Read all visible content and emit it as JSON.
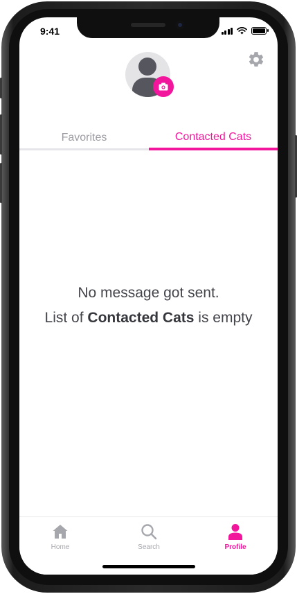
{
  "status_bar": {
    "time": "9:41"
  },
  "profile": {
    "avatar_icon": "user-silhouette-icon",
    "camera_icon": "camera-icon",
    "settings_icon": "gear-icon"
  },
  "tabs": [
    {
      "label": "Favorites",
      "active": false
    },
    {
      "label": "Contacted Cats",
      "active": true
    }
  ],
  "empty_state": {
    "line1": "No message got sent.",
    "line2_prefix": "List of ",
    "line2_bold": "Contacted Cats",
    "line2_suffix": " is empty"
  },
  "bottom_nav": [
    {
      "label": "Home",
      "icon": "home-icon",
      "active": false
    },
    {
      "label": "Search",
      "icon": "search-icon",
      "active": false
    },
    {
      "label": "Profile",
      "icon": "profile-icon",
      "active": true
    }
  ],
  "colors": {
    "accent": "#f2169c",
    "inactive": "#a6a7ad",
    "text": "#44454b"
  }
}
